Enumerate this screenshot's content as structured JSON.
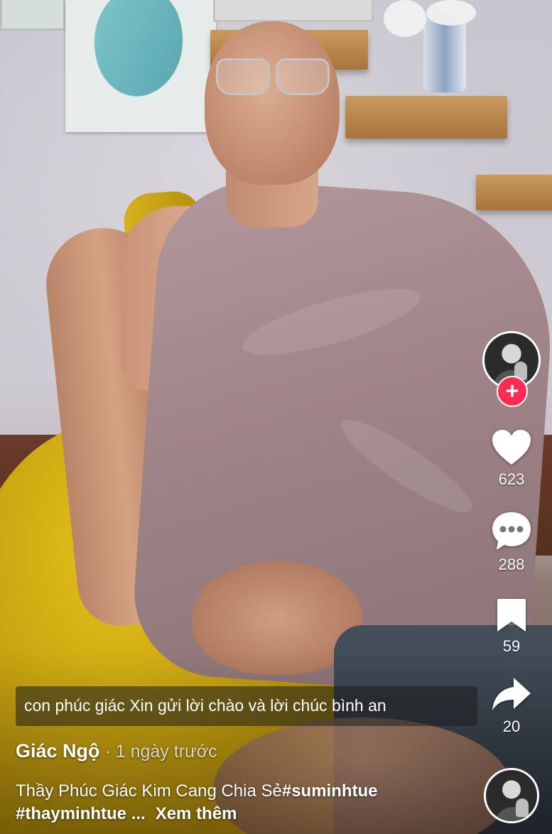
{
  "video": {
    "subtitle": "con phúc giác Xin gửi lời chào và lời chúc bình an"
  },
  "actions": {
    "likes": "623",
    "comments": "288",
    "saves": "59",
    "shares": "20"
  },
  "author": {
    "name": "Giác Ngộ",
    "separator": " · ",
    "posted": "1 ngày trước"
  },
  "caption": {
    "text": "Thầy Phúc Giác Kim Cang Chia Sẻ",
    "hashtags": "#suminhtue #thayminhtue ...",
    "more_label": "Xem thêm"
  },
  "icons": {
    "follow": "plus-icon",
    "like": "heart-icon",
    "comment": "comment-bubble-icon",
    "save": "bookmark-icon",
    "share": "share-arrow-icon"
  },
  "colors": {
    "follow_accent": "#fe2c55",
    "icon": "#ffffff"
  }
}
